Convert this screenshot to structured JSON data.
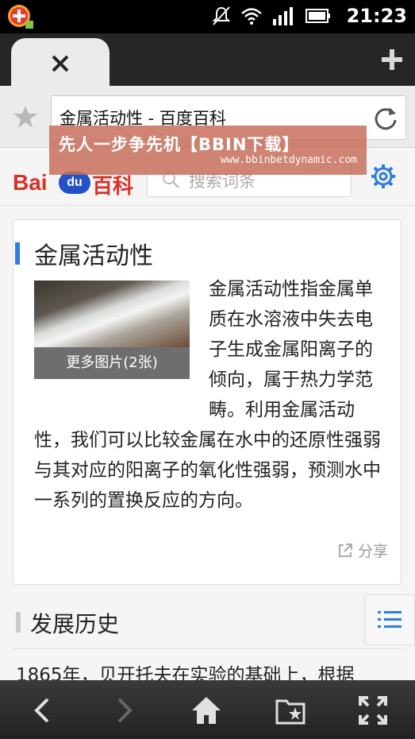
{
  "status_bar": {
    "time": "21:23",
    "icons": [
      "app-badge-icon",
      "mute-icon",
      "wifi-icon",
      "signal-icon",
      "battery-icon"
    ]
  },
  "tabs": {
    "close_icon": "close-icon",
    "new_tab_icon": "plus-icon"
  },
  "address_bar": {
    "url_text": "金属活动性 - 百度百科",
    "bookmark_icon": "star-icon",
    "reload_icon": "reload-icon"
  },
  "banner": {
    "title": "先人一步争先机【BBIN下载】",
    "url": "www.bbinbetdynamic.com"
  },
  "site_header": {
    "logo_bai": "Bai",
    "logo_du": "du",
    "logo_baike": "百科",
    "search_placeholder": "搜索词条",
    "settings_icon": "gear-icon"
  },
  "article": {
    "title": "金属活动性",
    "image_caption": "更多图片(2张)",
    "description": "金属活动性指金属单质在水溶液中失去电子生成金属阳离子的倾向，属于热力学范畴。利用金属活动性，我们可以比较金属在水中的还原性强弱与其对应的阳离子的氧化性强弱，预测水中一系列的置换反应的方向。",
    "share_label": "分享"
  },
  "section": {
    "title": "发展历史",
    "body_preview": "1865年，贝开托夫在实验的基础上，根据"
  },
  "bottom_bar": {
    "icons": [
      "back-icon",
      "forward-icon",
      "home-icon",
      "bookmarks-icon",
      "fullscreen-icon"
    ]
  },
  "colors": {
    "accent_blue": "#2f7de1",
    "baidu_red": "#d93025",
    "baidu_blue": "#2352c8",
    "banner_bg": "#c86e5a"
  }
}
